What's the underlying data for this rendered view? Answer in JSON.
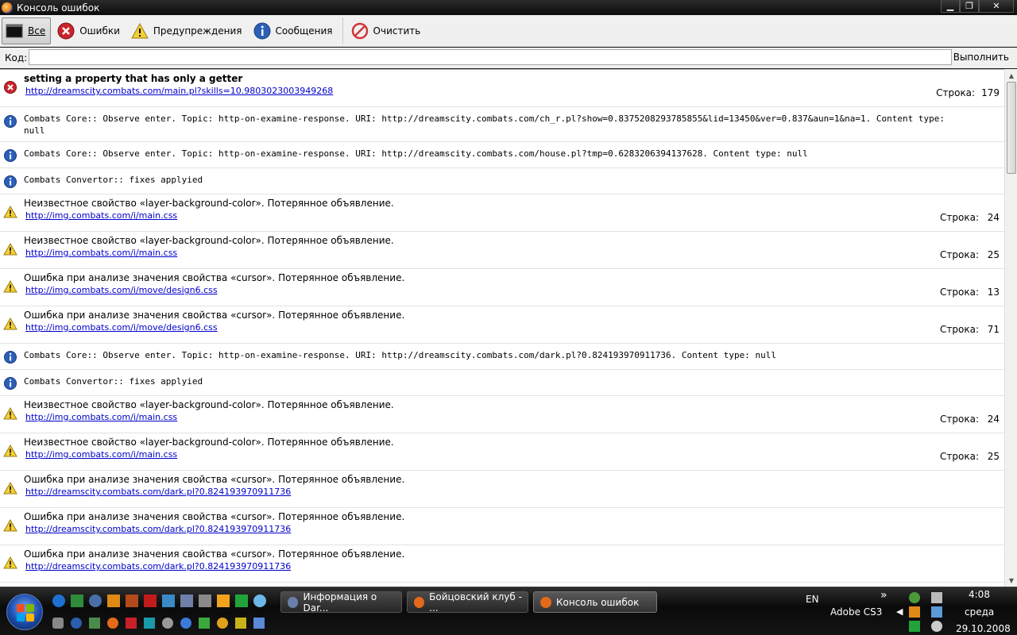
{
  "window": {
    "title": "Консоль ошибок"
  },
  "toolbar": {
    "all": "Все",
    "errors": "Ошибки",
    "warnings": "Предупреждения",
    "messages": "Сообщения",
    "clear": "Очистить"
  },
  "code": {
    "label": "Код:",
    "value": "",
    "execute": "Выполнить"
  },
  "line_label": "Строка:",
  "entries": [
    {
      "type": "error",
      "message": "setting a property that has only a getter",
      "source": "http://dreamscity.combats.com/main.pl?skills=10.9803023003949268",
      "line": "179"
    },
    {
      "type": "info",
      "message": "Combats Core:: Observe enter. Topic: http-on-examine-response. URI: http://dreamscity.combats.com/ch_r.pl?show=0.8375208293785855&lid=13450&ver=0.837&aun=1&na=1. Content type: null"
    },
    {
      "type": "info",
      "message": "Combats Core:: Observe enter. Topic: http-on-examine-response. URI: http://dreamscity.combats.com/house.pl?tmp=0.6283206394137628. Content type: null"
    },
    {
      "type": "info",
      "message": "Combats Convertor:: fixes applyied"
    },
    {
      "type": "warning",
      "message": "Неизвестное свойство «layer-background-color». Потерянное объявление.",
      "source": "http://img.combats.com/i/main.css",
      "line": "24"
    },
    {
      "type": "warning",
      "message": "Неизвестное свойство «layer-background-color». Потерянное объявление.",
      "source": "http://img.combats.com/i/main.css",
      "line": "25"
    },
    {
      "type": "warning",
      "message": "Ошибка при анализе значения свойства «cursor». Потерянное объявление.",
      "source": "http://img.combats.com/i/move/design6.css",
      "line": "13"
    },
    {
      "type": "warning",
      "message": "Ошибка при анализе значения свойства «cursor». Потерянное объявление.",
      "source": "http://img.combats.com/i/move/design6.css",
      "line": "71"
    },
    {
      "type": "info",
      "message": "Combats Core:: Observe enter. Topic: http-on-examine-response. URI: http://dreamscity.combats.com/dark.pl?0.824193970911736. Content type: null"
    },
    {
      "type": "info",
      "message": "Combats Convertor:: fixes applyied"
    },
    {
      "type": "warning",
      "message": "Неизвестное свойство «layer-background-color». Потерянное объявление.",
      "source": "http://img.combats.com/i/main.css",
      "line": "24"
    },
    {
      "type": "warning",
      "message": "Неизвестное свойство «layer-background-color». Потерянное объявление.",
      "source": "http://img.combats.com/i/main.css",
      "line": "25"
    },
    {
      "type": "warning",
      "message": "Ошибка при анализе значения свойства «cursor». Потерянное объявление.",
      "source": "http://dreamscity.combats.com/dark.pl?0.824193970911736"
    },
    {
      "type": "warning",
      "message": "Ошибка при анализе значения свойства «cursor». Потерянное объявление.",
      "source": "http://dreamscity.combats.com/dark.pl?0.824193970911736"
    },
    {
      "type": "warning",
      "message": "Ошибка при анализе значения свойства «cursor». Потерянное объявление.",
      "source": "http://dreamscity.combats.com/dark.pl?0.824193970911736"
    }
  ],
  "taskbar": {
    "tasks": [
      {
        "label": "Информация о Dar...",
        "icon": "browser-icon"
      },
      {
        "label": "Бойцовский клуб - ...",
        "icon": "firefox-icon"
      },
      {
        "label": "Консоль ошибок",
        "icon": "firefox-icon"
      }
    ],
    "language": "EN",
    "toolbar_name": "Adobe CS3",
    "time": "4:08",
    "day": "среда",
    "date": "29.10.2008"
  }
}
